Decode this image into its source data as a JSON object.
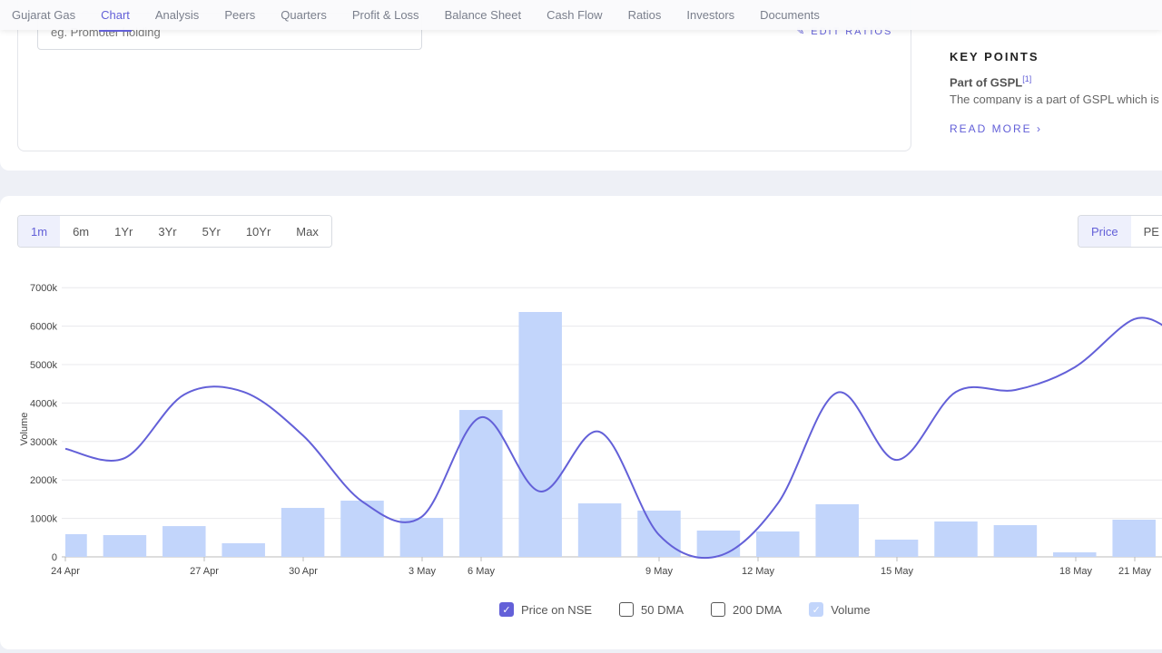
{
  "nav": {
    "items": [
      "Gujarat Gas",
      "Chart",
      "Analysis",
      "Peers",
      "Quarters",
      "Profit & Loss",
      "Balance Sheet",
      "Cash Flow",
      "Ratios",
      "Investors",
      "Documents"
    ],
    "active": "Chart"
  },
  "ratios": {
    "input_placeholder": "eg. Promoter holding",
    "edit_label": "EDIT RATIOS"
  },
  "key_points": {
    "title": "KEY POINTS",
    "subtitle": "Part of GSPL",
    "ref": "[1]",
    "text": "The company is a part of GSPL which is",
    "read_more": "READ MORE"
  },
  "periods": {
    "items": [
      "1m",
      "6m",
      "1Yr",
      "3Yr",
      "5Yr",
      "10Yr",
      "Max"
    ],
    "active": "1m"
  },
  "chart_types": {
    "items": [
      "Price",
      "PE"
    ],
    "active": "Price"
  },
  "legend": [
    {
      "label": "Price on NSE",
      "checked": true
    },
    {
      "label": "50 DMA",
      "checked": false
    },
    {
      "label": "200 DMA",
      "checked": false
    },
    {
      "label": "Volume",
      "checked": true
    }
  ],
  "colors": {
    "accent": "#6360d8",
    "volume": "#c2d5fb",
    "price_line": "#6360d8"
  },
  "chart_data": {
    "type": "bar+line",
    "ylabel": "Volume",
    "ylim": [
      0,
      7000
    ],
    "yticks": [
      "0",
      "1000k",
      "2000k",
      "3000k",
      "4000k",
      "5000k",
      "6000k",
      "7000k"
    ],
    "xticks": [
      "24 Apr",
      "27 Apr",
      "30 Apr",
      "3 May",
      "6 May",
      "9 May",
      "12 May",
      "15 May",
      "18 May",
      "21 May"
    ],
    "grid": true,
    "series": [
      {
        "name": "Volume",
        "type": "bar",
        "unit": "k",
        "values": [
          590,
          566,
          800,
          354,
          1273,
          1462,
          1014,
          3820,
          6368,
          1391,
          1203,
          684,
          660,
          1368,
          448,
          920,
          825,
          118,
          967
        ]
      },
      {
        "name": "Price on NSE",
        "type": "line",
        "note_scale": "relative (price axis not visible)",
        "values": [
          2810,
          2570,
          4220,
          4290,
          3160,
          1440,
          1040,
          3630,
          1700,
          3250,
          570,
          20,
          1390,
          4270,
          2520,
          4290,
          4340,
          4930,
          6180,
          5900
        ]
      }
    ]
  }
}
